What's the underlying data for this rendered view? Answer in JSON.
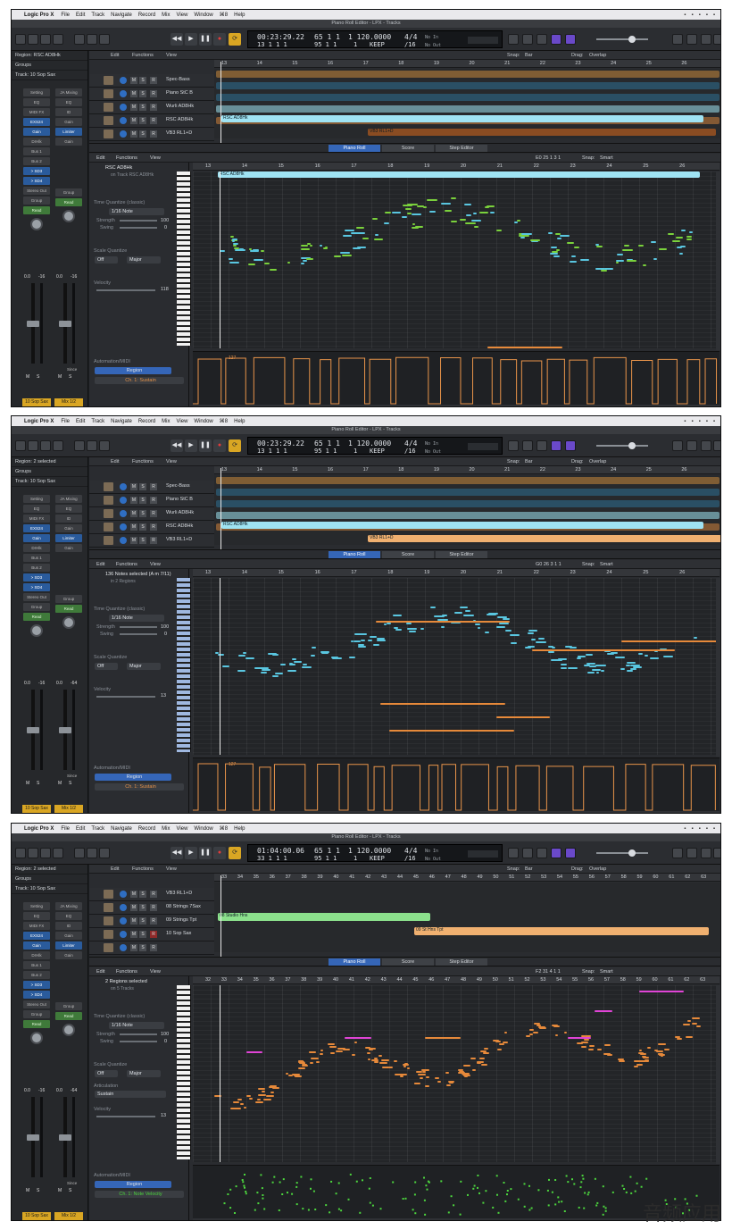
{
  "menubar": {
    "app": "Logic Pro X",
    "items": [
      "File",
      "Edit",
      "Track",
      "Navigate",
      "Record",
      "Mix",
      "View",
      "Window",
      "⌘8",
      "Help"
    ]
  },
  "colors": {
    "region_cyan": "#9fe3f3",
    "region_orange": "#f0b070",
    "region_green": "#8be08c",
    "note_green": "#7ad13c",
    "note_cyan": "#59c6e0",
    "note_orange": "#e6893a",
    "note_magenta": "#e044d6",
    "automation_orange": "#e8944a",
    "automation_green": "#4cd63e",
    "accent_blue": "#3566b8",
    "accent_yellow": "#d9a623"
  },
  "screens": [
    {
      "window_title": "Piano Roll Editor - LPX - Tracks",
      "lcd": {
        "time": "00:23:29.22",
        "bars": "13  1  1     1",
        "beat": "65  1  1",
        "sub": "95  1  1",
        "tempo_a": "1  120.0000",
        "tempo_b": "1",
        "sig": "4/4",
        "div": "/16",
        "key": "KEEP",
        "in": "No In",
        "out": "No Out"
      },
      "inspector": {
        "region": "Region: RSC AD8Hk",
        "groups": "Groups",
        "track": "Track:  10 Sop Sax"
      },
      "strips": {
        "left": {
          "setting": "Setting",
          "eq": "EQ",
          "midi": "MIDI FX",
          "inst": "EXS24",
          "gain": "Gain",
          "send": "DrHlk",
          "bus1": "Bus 1",
          "bus2": "Bus 2",
          "bus3": "> SD3",
          "bus4": "> SD4",
          "out": "Stereo Out",
          "group": "Group",
          "auto": "Read",
          "vol": "0.0",
          "pan": "-16",
          "m": "M",
          "s": "S",
          "name": "10 Sop Sax"
        },
        "right": {
          "setting": "JA Mixing",
          "eq": "EQ",
          "midi": "ID",
          "inst": "Gain",
          "gain": "Limiter",
          "send": "Gain",
          "out": "Group",
          "auto": "Read",
          "vol": "0.0",
          "pan": "-16",
          "m": "M",
          "s": "S",
          "since": "Since",
          "name": "Mix 1/2"
        }
      },
      "tracks_toolbar": {
        "edit": "Edit",
        "functions": "Functions",
        "view": "View",
        "snap": "Snap:",
        "snap_val": "Bar",
        "drag": "Drag:",
        "drag_val": "Overlap"
      },
      "ruler": [
        "13",
        "14",
        "15",
        "16",
        "17",
        "18",
        "19",
        "20",
        "21",
        "22",
        "23",
        "24",
        "25",
        "26"
      ],
      "tracks": [
        {
          "num": "",
          "name": "Spec-Bass"
        },
        {
          "num": "",
          "name": "Piano StC B"
        },
        {
          "num": "",
          "name": "Wurli AD8Hk"
        },
        {
          "num": "",
          "name": "RSC AD8Hk"
        },
        {
          "num": "",
          "name": "VB3 RL1+D"
        }
      ],
      "regions": [
        {
          "name": "RSC AD8Hk"
        },
        {
          "name": "VB3 RL1+D"
        }
      ],
      "tabs": [
        "Piano Roll",
        "Score",
        "Step Editor"
      ],
      "pr": {
        "edit": "Edit",
        "functions": "Functions",
        "view": "View",
        "pos": "E0  25 1 3 1",
        "snap": "Snap:",
        "snap_val": "Smart",
        "region_title": "RSC AD8Hk",
        "region_sub": "on Track RSC AD8Hk",
        "tq": "Time Quantize (classic)",
        "tq_val": "1/16 Note",
        "strength": "Strength",
        "strength_val": "100",
        "swing": "Swing",
        "swing_val": "0",
        "sq": "Scale Quantize",
        "sq_off": "Off",
        "sq_major": "Major",
        "velocity": "Velocity",
        "velocity_val": "118",
        "auto": "Automation/MIDI",
        "auto_region": "Region",
        "auto_param": "Ch. 1: Sustain",
        "region_bar": "RSC AD8Hk",
        "auto_val": "127"
      },
      "pr_ruler": [
        "13",
        "14",
        "15",
        "16",
        "17",
        "18",
        "19",
        "20",
        "21",
        "22",
        "23",
        "24",
        "25",
        "26"
      ]
    },
    {
      "window_title": "Piano Roll Editor - LPX - Tracks",
      "lcd": {
        "time": "00:23:29.22",
        "bars": "13  1  1     1",
        "beat": "65  1  1",
        "sub": "95  1  1",
        "tempo_a": "1  120.0000",
        "tempo_b": "1",
        "sig": "4/4",
        "div": "/16",
        "key": "KEEP",
        "in": "No In",
        "out": "No Out"
      },
      "inspector": {
        "region": "Region: 2 selected",
        "groups": "Groups",
        "track": "Track:  10 Sop Sax"
      },
      "strips": {
        "left": {
          "setting": "Setting",
          "eq": "EQ",
          "midi": "MIDI FX",
          "inst": "EXS24",
          "gain": "Gain",
          "send": "DrHlk",
          "bus1": "Bus 1",
          "bus2": "Bus 2",
          "bus3": "> SD3",
          "bus4": "> SD4",
          "out": "Stereo Out",
          "group": "Group",
          "auto": "Read",
          "vol": "0.0",
          "pan": "-16",
          "m": "M",
          "s": "S",
          "name": "10 Sop Sax"
        },
        "right": {
          "setting": "JA Mixing",
          "eq": "EQ",
          "midi": "ID",
          "inst": "Gain",
          "gain": "Limiter",
          "send": "Gain",
          "out": "Group",
          "auto": "Read",
          "vol": "0.0",
          "pan": "-64",
          "m": "M",
          "s": "S",
          "since": "Since",
          "name": "Mix 1/2"
        }
      },
      "tracks_toolbar": {
        "edit": "Edit",
        "functions": "Functions",
        "view": "View",
        "snap": "Snap:",
        "snap_val": "Bar",
        "drag": "Drag:",
        "drag_val": "Overlap"
      },
      "ruler": [
        "13",
        "14",
        "15",
        "16",
        "17",
        "18",
        "19",
        "20",
        "21",
        "22",
        "23",
        "24",
        "25",
        "26"
      ],
      "tracks": [
        {
          "num": "",
          "name": "Spec-Bass"
        },
        {
          "num": "",
          "name": "Piano StC B"
        },
        {
          "num": "",
          "name": "Wurli AD8Hk"
        },
        {
          "num": "",
          "name": "RSC AD8Hk"
        },
        {
          "num": "",
          "name": "VB3 RL1+D"
        }
      ],
      "regions": [
        {
          "name": "RSC AD8Hk"
        },
        {
          "name": "VB3 RL1+D"
        }
      ],
      "tabs": [
        "Piano Roll",
        "Score",
        "Step Editor"
      ],
      "pr": {
        "edit": "Edit",
        "functions": "Functions",
        "view": "View",
        "pos": "G0  26 3 1 1",
        "snap": "Snap:",
        "snap_val": "Smart",
        "region_title": "136 Notes selected (A m 7/11)",
        "region_sub": "in 2 Regions",
        "tq": "Time Quantize (classic)",
        "tq_val": "1/16 Note",
        "strength": "Strength",
        "strength_val": "100",
        "swing": "Swing",
        "swing_val": "0",
        "sq": "Scale Quantize",
        "sq_off": "Off",
        "sq_major": "Major",
        "velocity": "Velocity",
        "velocity_val": "13",
        "auto": "Automation/MIDI",
        "auto_region": "Region",
        "auto_param": "Ch. 1: Sustain",
        "region_bar": "",
        "auto_val": "127"
      },
      "pr_ruler": [
        "13",
        "14",
        "15",
        "16",
        "17",
        "18",
        "19",
        "20",
        "21",
        "22",
        "23",
        "24",
        "25",
        "26"
      ]
    },
    {
      "window_title": "Piano Roll Editor - LPX - Tracks",
      "lcd": {
        "time": "01:04:00.06",
        "bars": "33  1  1     1",
        "beat": "65  1  1",
        "sub": "95  1  1",
        "tempo_a": "1  120.0000",
        "tempo_b": "1",
        "sig": "4/4",
        "div": "/16",
        "key": "KEEP",
        "in": "No In",
        "out": "No Out"
      },
      "inspector": {
        "region": "Region: 2 selected",
        "groups": "Groups",
        "track": "Track:  10 Sop Sax"
      },
      "strips": {
        "left": {
          "setting": "Setting",
          "eq": "EQ",
          "midi": "MIDI FX",
          "inst": "EXS24",
          "gain": "Gain",
          "send": "DrHlk",
          "bus1": "Bus 1",
          "bus2": "Bus 2",
          "bus3": "> SD3",
          "bus4": "> SD4",
          "out": "Stereo Out",
          "group": "Group",
          "auto": "Read",
          "vol": "0.0",
          "pan": "-16",
          "m": "M",
          "s": "S",
          "name": "10 Sop Sax"
        },
        "right": {
          "setting": "JA Mixing",
          "eq": "EQ",
          "midi": "ID",
          "inst": "Gain",
          "gain": "Limiter",
          "send": "Gain",
          "out": "Group",
          "auto": "Read",
          "vol": "0.0",
          "pan": "-64",
          "m": "M",
          "s": "S",
          "since": "Since",
          "name": "Mix 1/2"
        }
      },
      "tracks_toolbar": {
        "edit": "Edit",
        "functions": "Functions",
        "view": "View",
        "snap": "Snap:",
        "snap_val": "Bar",
        "drag": "Drag:",
        "drag_val": "Overlap"
      },
      "ruler": [
        "33",
        "34",
        "35",
        "36",
        "37",
        "38",
        "39",
        "40",
        "41",
        "42",
        "43",
        "44",
        "45",
        "46",
        "47",
        "48",
        "49",
        "50",
        "51",
        "52",
        "53",
        "54",
        "55",
        "56",
        "57",
        "58",
        "59",
        "60",
        "61",
        "62",
        "63"
      ],
      "tracks": [
        {
          "num": "",
          "name": "VB3 RL1+D"
        },
        {
          "num": "",
          "name": "08 Strings 7Sax"
        },
        {
          "num": "",
          "name": "09 Strings Tpt"
        },
        {
          "num": "",
          "name": "10 Sop Sax"
        },
        {
          "num": "",
          "name": ""
        }
      ],
      "regions": [
        {
          "name": "08 Studio Hns"
        },
        {
          "name": "09 St Hns Tpt"
        }
      ],
      "tabs": [
        "Piano Roll",
        "Score",
        "Step Editor"
      ],
      "pr": {
        "edit": "Edit",
        "functions": "Functions",
        "view": "View",
        "pos": "F2  31 4 1 1",
        "snap": "Snap:",
        "snap_val": "Smart",
        "region_title": "2 Regions selected",
        "region_sub": "on 5 Tracks",
        "tq": "Time Quantize (classic)",
        "tq_val": "1/16 Note",
        "strength": "Strength",
        "strength_val": "100",
        "swing": "Swing",
        "swing_val": "0",
        "sq": "Scale Quantize",
        "sq_off": "Off",
        "sq_major": "Major",
        "articulation": "Articulation",
        "articulation_val": "Sustain",
        "velocity": "Velocity",
        "velocity_val": "13",
        "auto": "Automation/MIDI",
        "auto_region": "Region",
        "auto_param": "Ch. 1: Note Velocity",
        "region_bar": "",
        "auto_val": ""
      },
      "pr_ruler": [
        "32",
        "33",
        "34",
        "35",
        "36",
        "37",
        "38",
        "39",
        "40",
        "41",
        "42",
        "43",
        "44",
        "45",
        "46",
        "47",
        "48",
        "49",
        "50",
        "51",
        "52",
        "53",
        "54",
        "55",
        "56",
        "57",
        "58",
        "59",
        "60",
        "61",
        "62",
        "63"
      ]
    }
  ],
  "watermark": "音频应用"
}
